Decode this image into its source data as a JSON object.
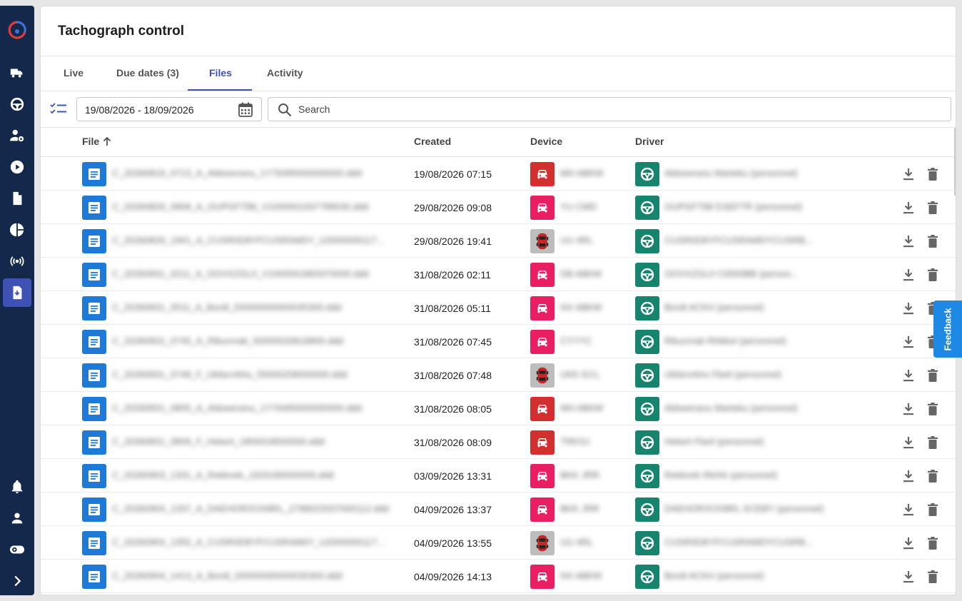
{
  "app": {
    "title": "Tachograph control"
  },
  "tabs": [
    {
      "label": "Live"
    },
    {
      "label": "Due dates (3)"
    },
    {
      "label": "Files"
    },
    {
      "label": "Activity"
    }
  ],
  "active_tab": "Files",
  "filters": {
    "date_range": "19/08/2026 - 18/09/2026",
    "search_placeholder": "Search"
  },
  "table": {
    "columns": {
      "file": "File",
      "created": "Created",
      "device": "Device",
      "driver": "Driver"
    },
    "sort": {
      "column": "File",
      "direction": "ascending"
    },
    "rows": [
      {
        "file": "C_20260819_0713_A_Aldoeeranu_1Y76495000000000.ddd",
        "created": "19/08/2026 07:15",
        "device_type": "car-red",
        "device": "MH ABKM",
        "driver": "Aldoeeranu Marteku (personnel)"
      },
      {
        "file": "C_20260829_0908_A_OUPGFT88_V1000001937789030.ddd",
        "created": "29/08/2026 09:08",
        "device_type": "car-pink",
        "device": "YU CMD",
        "driver": "OUPGFT88 ESEFTR (personnel)"
      },
      {
        "file": "C_20260829_1941_A_CUSR0D8YFCUSRAM0Y_U2000000117...",
        "created": "29/08/2026 19:41",
        "device_type": "car-photo",
        "device": "UU 4RL",
        "driver": "CUSR0D8YFCUSRAMDYCUSRB..."
      },
      {
        "file": "C_20260831_0211_A_OOVXZGL0_V1000001883370000.ddd",
        "created": "31/08/2026 02:11",
        "device_type": "car-pink",
        "device": "DB ABKM",
        "driver": "OOVXZGL0 C0000BB (person..."
      },
      {
        "file": "C_20260831_0511_A_Bordt_D0000000000035300.ddd",
        "created": "31/08/2026 05:11",
        "device_type": "car-pink",
        "device": "NX ABKM",
        "driver": "Bordt ACKH (personnel)"
      },
      {
        "file": "C_20260831_0745_A_Rtkurvrab_50000033818800.ddd",
        "created": "31/08/2026 07:45",
        "device_type": "car-pink",
        "device": "CYYYC",
        "driver": "Rtkurvrab Rhbbol (personnel)"
      },
      {
        "file": "C_20260831_0748_F_Ukfarvrkho_55000258000000.ddd",
        "created": "31/08/2026 07:48",
        "device_type": "car-photo",
        "device": "UKK ECL",
        "driver": "Ukfarvrkho Fbeil (personnel)"
      },
      {
        "file": "C_20260831_0805_A_Aldoeeranu_1Y76495000000000.ddd",
        "created": "31/08/2026 08:05",
        "device_type": "car-red",
        "device": "MH ABKM",
        "driver": "Aldoeeranu Marteku (personnel)"
      },
      {
        "file": "C_20260831_0809_F_Hekert_1800018000000.ddd",
        "created": "31/08/2026 08:09",
        "device_type": "car-red",
        "device": "TRKSJ",
        "driver": "Hekert Fbeil (personnel)"
      },
      {
        "file": "C_20260903_1331_A_Rekknek_1920180000000.ddd",
        "created": "03/09/2026 13:31",
        "device_type": "car-pink",
        "device": "BKK JRR",
        "driver": "Rekknek Rkrhh (personnel)"
      },
      {
        "file": "C_20260904_1337_A_DAEHORXOX8RL_2788023337000112.ddd",
        "created": "04/09/2026 13:37",
        "device_type": "car-pink",
        "device": "BKK JRR",
        "driver": "DAEHORXOX8RL SCEBY (personnel)"
      },
      {
        "file": "C_20260904_1355_A_CUSR0D8YFCUSRAM0Y_U2000000117...",
        "created": "04/09/2026 13:55",
        "device_type": "car-photo",
        "device": "UU 4RL",
        "driver": "CUSR0D8YFCUSRAMDYCUSRB..."
      },
      {
        "file": "C_20260904_1413_A_Bordt_D0000000000035300.ddd",
        "created": "04/09/2026 14:13",
        "device_type": "car-pink",
        "device": "NX ABKM",
        "driver": "Bordt ACKH (personnel)"
      }
    ]
  },
  "feedback": {
    "label": "Feedback"
  },
  "colors": {
    "sidebar": "#14284b",
    "accent": "#3f51b5",
    "file_icon": "#1e7ad6",
    "car_red": "#d32f2f",
    "car_pink": "#e91e63",
    "driver_icon": "#17846e",
    "feedback": "#1e88e5"
  },
  "sidebar_icons": [
    "app-logo",
    "fleet-icon",
    "steering-wheel-icon",
    "driver-settings-icon",
    "play-circle-icon",
    "document-icon",
    "pie-chart-icon",
    "broadcast-icon",
    "tachograph-download-icon",
    "bell-icon",
    "user-icon",
    "settings-toggle-icon",
    "chevron-right-icon"
  ]
}
